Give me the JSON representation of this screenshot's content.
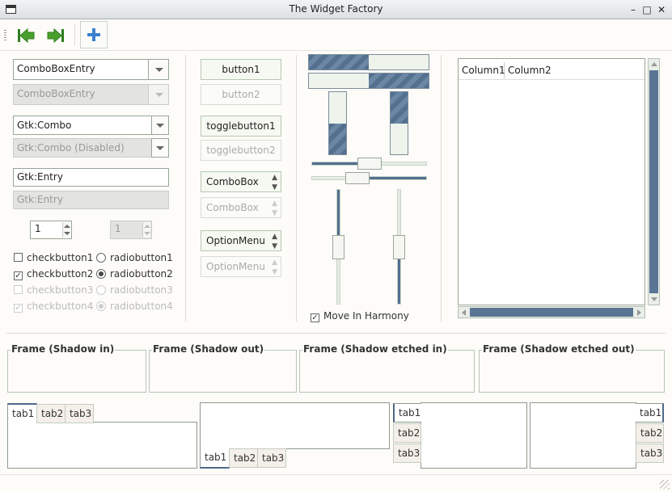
{
  "window": {
    "title": "The Widget Factory"
  },
  "toolbar": {
    "buttons": [
      {
        "icon": "go-first-icon",
        "color": "#2f7d1e"
      },
      {
        "icon": "go-last-icon",
        "color": "#2f7d1e"
      },
      {
        "icon": "add-icon",
        "color": "#3a7fd0"
      }
    ]
  },
  "left": {
    "combo_entry": "ComboBoxEntry",
    "combo_entry_disabled": "ComboBoxEntry",
    "gtk_combo": "Gtk:Combo",
    "gtk_combo_disabled": "Gtk:Combo (Disabled)",
    "entry": "Gtk:Entry",
    "entry_disabled": "Gtk:Entry",
    "spin1": "1",
    "spin2": "1",
    "checks": [
      "checkbutton1",
      "checkbutton2",
      "checkbutton3",
      "checkbutton4"
    ],
    "radios": [
      "radiobutton1",
      "radiobutton2",
      "radiobutton3",
      "radiobutton4"
    ]
  },
  "middle": {
    "button1": "button1",
    "button2": "button2",
    "toggle1": "togglebutton1",
    "toggle2": "togglebutton2",
    "combobox": "ComboBox",
    "combobox_disabled": "ComboBox",
    "optionmenu": "OptionMenu",
    "optionmenu_disabled": "OptionMenu"
  },
  "ranges": {
    "hprogress1": 0.5,
    "hprogress2": 0.5,
    "vprogress1": 0.5,
    "vprogress2": 0.5,
    "hscale1": 0.5,
    "hscale2": 0.5,
    "vscale1": 0.5,
    "vscale2": 0.5,
    "move_in_harmony": "Move In Harmony"
  },
  "tree": {
    "columns": [
      "Column1",
      "Column2"
    ]
  },
  "frames": [
    "Frame (Shadow in)",
    "Frame (Shadow out)",
    "Frame (Shadow etched in)",
    "Frame (Shadow etched out)"
  ],
  "notebooks": {
    "tabs": [
      "tab1",
      "tab2",
      "tab3"
    ]
  },
  "colors": {
    "accent": "#53708f",
    "background": "#fdfcf8"
  }
}
